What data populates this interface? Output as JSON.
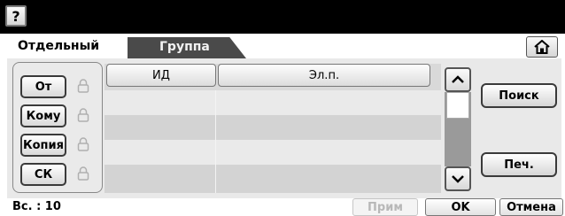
{
  "header": {
    "help_label": "?"
  },
  "tabs": [
    {
      "label": "Отдельный",
      "active": true
    },
    {
      "label": "Группа",
      "active": false
    }
  ],
  "recipients": [
    {
      "label": "От"
    },
    {
      "label": "Кому"
    },
    {
      "label": "Копия"
    },
    {
      "label": "СК"
    }
  ],
  "table": {
    "columns": [
      "ИД",
      "Эл.п."
    ],
    "rows": [
      [
        "",
        ""
      ],
      [
        "",
        ""
      ],
      [
        "",
        ""
      ],
      [
        "",
        ""
      ]
    ]
  },
  "actions": {
    "search_label": "Поиск",
    "print_label": "Печ."
  },
  "footer": {
    "total": "Вс. : 10",
    "apply_label": "Прим",
    "ok_label": "OK",
    "cancel_label": "Отмена"
  },
  "icons": {
    "help": "help-icon",
    "home": "home-icon",
    "lock": "lock-icon",
    "up": "chevron-up-icon",
    "down": "chevron-down-icon"
  }
}
